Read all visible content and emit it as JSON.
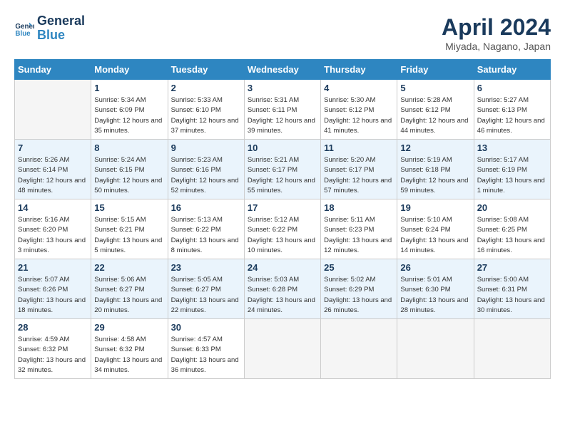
{
  "header": {
    "logo_line1": "General",
    "logo_line2": "Blue",
    "month_title": "April 2024",
    "location": "Miyada, Nagano, Japan"
  },
  "days_of_week": [
    "Sunday",
    "Monday",
    "Tuesday",
    "Wednesday",
    "Thursday",
    "Friday",
    "Saturday"
  ],
  "weeks": [
    [
      {
        "day": "",
        "empty": true
      },
      {
        "day": "1",
        "sunrise": "Sunrise: 5:34 AM",
        "sunset": "Sunset: 6:09 PM",
        "daylight": "Daylight: 12 hours and 35 minutes."
      },
      {
        "day": "2",
        "sunrise": "Sunrise: 5:33 AM",
        "sunset": "Sunset: 6:10 PM",
        "daylight": "Daylight: 12 hours and 37 minutes."
      },
      {
        "day": "3",
        "sunrise": "Sunrise: 5:31 AM",
        "sunset": "Sunset: 6:11 PM",
        "daylight": "Daylight: 12 hours and 39 minutes."
      },
      {
        "day": "4",
        "sunrise": "Sunrise: 5:30 AM",
        "sunset": "Sunset: 6:12 PM",
        "daylight": "Daylight: 12 hours and 41 minutes."
      },
      {
        "day": "5",
        "sunrise": "Sunrise: 5:28 AM",
        "sunset": "Sunset: 6:12 PM",
        "daylight": "Daylight: 12 hours and 44 minutes."
      },
      {
        "day": "6",
        "sunrise": "Sunrise: 5:27 AM",
        "sunset": "Sunset: 6:13 PM",
        "daylight": "Daylight: 12 hours and 46 minutes."
      }
    ],
    [
      {
        "day": "7",
        "sunrise": "Sunrise: 5:26 AM",
        "sunset": "Sunset: 6:14 PM",
        "daylight": "Daylight: 12 hours and 48 minutes."
      },
      {
        "day": "8",
        "sunrise": "Sunrise: 5:24 AM",
        "sunset": "Sunset: 6:15 PM",
        "daylight": "Daylight: 12 hours and 50 minutes."
      },
      {
        "day": "9",
        "sunrise": "Sunrise: 5:23 AM",
        "sunset": "Sunset: 6:16 PM",
        "daylight": "Daylight: 12 hours and 52 minutes."
      },
      {
        "day": "10",
        "sunrise": "Sunrise: 5:21 AM",
        "sunset": "Sunset: 6:17 PM",
        "daylight": "Daylight: 12 hours and 55 minutes."
      },
      {
        "day": "11",
        "sunrise": "Sunrise: 5:20 AM",
        "sunset": "Sunset: 6:17 PM",
        "daylight": "Daylight: 12 hours and 57 minutes."
      },
      {
        "day": "12",
        "sunrise": "Sunrise: 5:19 AM",
        "sunset": "Sunset: 6:18 PM",
        "daylight": "Daylight: 12 hours and 59 minutes."
      },
      {
        "day": "13",
        "sunrise": "Sunrise: 5:17 AM",
        "sunset": "Sunset: 6:19 PM",
        "daylight": "Daylight: 13 hours and 1 minute."
      }
    ],
    [
      {
        "day": "14",
        "sunrise": "Sunrise: 5:16 AM",
        "sunset": "Sunset: 6:20 PM",
        "daylight": "Daylight: 13 hours and 3 minutes."
      },
      {
        "day": "15",
        "sunrise": "Sunrise: 5:15 AM",
        "sunset": "Sunset: 6:21 PM",
        "daylight": "Daylight: 13 hours and 5 minutes."
      },
      {
        "day": "16",
        "sunrise": "Sunrise: 5:13 AM",
        "sunset": "Sunset: 6:22 PM",
        "daylight": "Daylight: 13 hours and 8 minutes."
      },
      {
        "day": "17",
        "sunrise": "Sunrise: 5:12 AM",
        "sunset": "Sunset: 6:22 PM",
        "daylight": "Daylight: 13 hours and 10 minutes."
      },
      {
        "day": "18",
        "sunrise": "Sunrise: 5:11 AM",
        "sunset": "Sunset: 6:23 PM",
        "daylight": "Daylight: 13 hours and 12 minutes."
      },
      {
        "day": "19",
        "sunrise": "Sunrise: 5:10 AM",
        "sunset": "Sunset: 6:24 PM",
        "daylight": "Daylight: 13 hours and 14 minutes."
      },
      {
        "day": "20",
        "sunrise": "Sunrise: 5:08 AM",
        "sunset": "Sunset: 6:25 PM",
        "daylight": "Daylight: 13 hours and 16 minutes."
      }
    ],
    [
      {
        "day": "21",
        "sunrise": "Sunrise: 5:07 AM",
        "sunset": "Sunset: 6:26 PM",
        "daylight": "Daylight: 13 hours and 18 minutes."
      },
      {
        "day": "22",
        "sunrise": "Sunrise: 5:06 AM",
        "sunset": "Sunset: 6:27 PM",
        "daylight": "Daylight: 13 hours and 20 minutes."
      },
      {
        "day": "23",
        "sunrise": "Sunrise: 5:05 AM",
        "sunset": "Sunset: 6:27 PM",
        "daylight": "Daylight: 13 hours and 22 minutes."
      },
      {
        "day": "24",
        "sunrise": "Sunrise: 5:03 AM",
        "sunset": "Sunset: 6:28 PM",
        "daylight": "Daylight: 13 hours and 24 minutes."
      },
      {
        "day": "25",
        "sunrise": "Sunrise: 5:02 AM",
        "sunset": "Sunset: 6:29 PM",
        "daylight": "Daylight: 13 hours and 26 minutes."
      },
      {
        "day": "26",
        "sunrise": "Sunrise: 5:01 AM",
        "sunset": "Sunset: 6:30 PM",
        "daylight": "Daylight: 13 hours and 28 minutes."
      },
      {
        "day": "27",
        "sunrise": "Sunrise: 5:00 AM",
        "sunset": "Sunset: 6:31 PM",
        "daylight": "Daylight: 13 hours and 30 minutes."
      }
    ],
    [
      {
        "day": "28",
        "sunrise": "Sunrise: 4:59 AM",
        "sunset": "Sunset: 6:32 PM",
        "daylight": "Daylight: 13 hours and 32 minutes."
      },
      {
        "day": "29",
        "sunrise": "Sunrise: 4:58 AM",
        "sunset": "Sunset: 6:32 PM",
        "daylight": "Daylight: 13 hours and 34 minutes."
      },
      {
        "day": "30",
        "sunrise": "Sunrise: 4:57 AM",
        "sunset": "Sunset: 6:33 PM",
        "daylight": "Daylight: 13 hours and 36 minutes."
      },
      {
        "day": "",
        "empty": true
      },
      {
        "day": "",
        "empty": true
      },
      {
        "day": "",
        "empty": true
      },
      {
        "day": "",
        "empty": true
      }
    ]
  ]
}
